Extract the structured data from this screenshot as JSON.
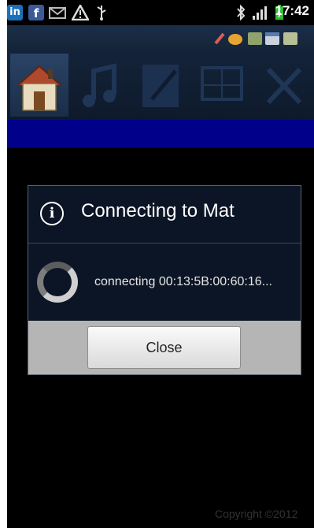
{
  "status_bar": {
    "clock": "17:42",
    "icons": [
      "linkedin-icon",
      "facebook-icon",
      "mail-icon",
      "warning-icon",
      "usb-icon",
      "bluetooth-icon",
      "signal-icon",
      "battery-icon"
    ],
    "linkedin_glyph": "in",
    "facebook_glyph": "f"
  },
  "notification_icons": [
    "pencil-icon",
    "app-icon",
    "settings-icon",
    "calendar-icon",
    "wifi-icon"
  ],
  "tabs": [
    {
      "name": "home",
      "icon": "house-icon",
      "active": true
    },
    {
      "name": "music",
      "icon": "music-note-icon",
      "active": false
    },
    {
      "name": "notes",
      "icon": "note-icon",
      "active": false
    },
    {
      "name": "screen",
      "icon": "monitor-icon",
      "active": false
    },
    {
      "name": "tools",
      "icon": "wrench-icon",
      "active": false
    }
  ],
  "dialog": {
    "title": "Connecting to Mat",
    "message": "connecting 00:13:5B:00:60:16...",
    "close_label": "Close"
  },
  "footer": {
    "copyright": "Copyright ©2012"
  },
  "colors": {
    "band_blue": "#00008b",
    "dialog_bg": "#0c1526",
    "footer_gray": "#b5b5b5"
  }
}
